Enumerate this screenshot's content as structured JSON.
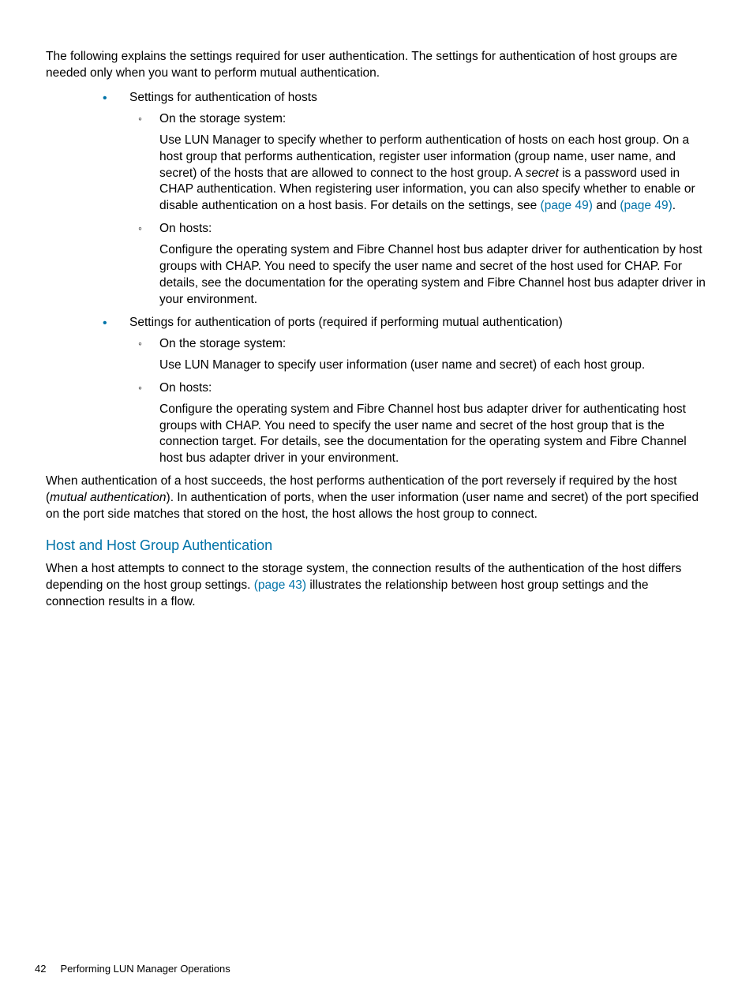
{
  "intro": "The following explains the settings required for user authentication. The settings for authentication of host groups are needed only when you want to perform mutual authentication.",
  "list1": {
    "item1": {
      "label": "Settings for authentication of hosts",
      "sub1": {
        "label": "On the storage system:",
        "p1a": "Use LUN Manager to specify whether to perform authentication of hosts on each host group. On a host group that performs authentication, register user information (group name, user name, and secret) of the hosts that are allowed to connect to the host group. A ",
        "p1_secret": "secret",
        "p1b": " is a password used in CHAP authentication. When registering user information, you can also specify whether to enable or disable authentication on a host basis. For details on the settings, see ",
        "link1": "(page 49)",
        "p1c": " and ",
        "link2": "(page 49)",
        "p1d": "."
      },
      "sub2": {
        "label": "On hosts:",
        "body": "Configure the operating system and Fibre Channel host bus adapter driver for authentication by host groups with CHAP. You need to specify the user name and secret of the host used for CHAP. For details, see the documentation for the operating system and Fibre Channel host bus adapter driver in your environment."
      }
    },
    "item2": {
      "label": "Settings for authentication of ports (required if performing mutual authentication)",
      "sub1": {
        "label": "On the storage system:",
        "body": "Use LUN Manager to specify user information (user name and secret) of each host group."
      },
      "sub2": {
        "label": "On hosts:",
        "body": "Configure the operating system and Fibre Channel host bus adapter driver for authenticating host groups with CHAP. You need to specify the user name and secret of the host group that is the connection target. For details, see the documentation for the operating system and Fibre Channel host bus adapter driver in your environment."
      }
    }
  },
  "para2a": "When authentication of a host succeeds, the host performs authentication of the port reversely if required by the host (",
  "para2_mutual": "mutual authentication",
  "para2b": "). In authentication of ports, when the user information (user name and secret) of the port specified on the port side matches that stored on the host, the host allows the host group to connect.",
  "section_title": "Host and Host Group Authentication",
  "para3a": "When a host attempts to connect to the storage system, the connection results of the authentication of the host differs depending on the host group settings. ",
  "para3_link": "(page 43)",
  "para3b": " illustrates the relationship between host group settings and the connection results in a flow.",
  "footer": {
    "page": "42",
    "title": "Performing LUN Manager Operations"
  }
}
